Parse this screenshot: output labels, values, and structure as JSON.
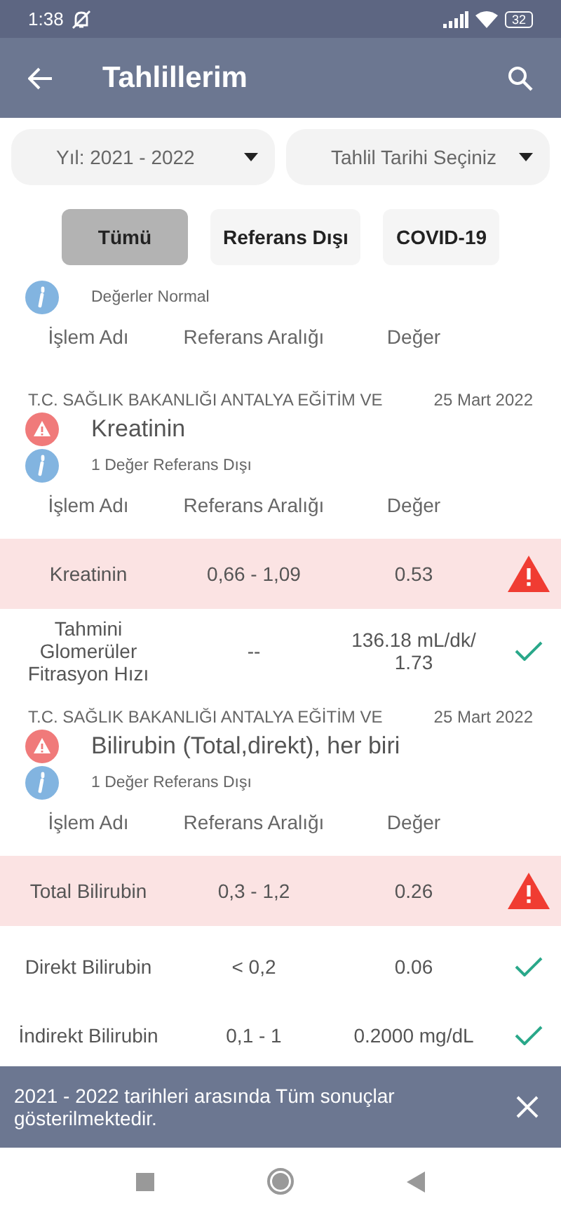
{
  "status_bar": {
    "time": "1:38",
    "battery": "32"
  },
  "app_bar": {
    "title": "Tahlillerim"
  },
  "dropdowns": [
    {
      "label": "Yıl: 2021 - 2022"
    },
    {
      "label": "Tahlil Tarihi Seçiniz"
    }
  ],
  "tabs": [
    {
      "label": "Tümü",
      "selected": true
    },
    {
      "label": "Referans Dışı",
      "selected": false
    },
    {
      "label": "COVID-19",
      "selected": false
    }
  ],
  "sections": [
    {
      "info": "Değerler Normal",
      "columns": [
        "İşlem Adı",
        "Referans Aralığı",
        "Değer"
      ]
    },
    {
      "hospital": "T.C. SAĞLIK BAKANLIĞI ANTALYA EĞİTİM VE",
      "date": "25 Mart 2022",
      "test_name": "Kreatinin",
      "alert": true,
      "info": "1 Değer Referans Dışı",
      "columns": [
        "İşlem Adı",
        "Referans Aralığı",
        "Değer"
      ],
      "rows": [
        {
          "name": "Kreatinin",
          "range": "0,66 - 1,09",
          "value": "0.53",
          "out_of_range": true
        },
        {
          "name": "Tahmini Glomerüler Fitrasyon Hızı",
          "range": "--",
          "value": "136.18 mL/dk/ 1.73",
          "out_of_range": false
        }
      ]
    },
    {
      "hospital": "T.C. SAĞLIK BAKANLIĞI ANTALYA EĞİTİM VE",
      "date": "25 Mart 2022",
      "test_name": "Bilirubin (Total,direkt), her biri",
      "alert": true,
      "info": "1 Değer Referans Dışı",
      "columns": [
        "İşlem Adı",
        "Referans Aralığı",
        "Değer"
      ],
      "rows": [
        {
          "name": "Total Bilirubin",
          "range": "0,3 - 1,2",
          "value": "0.26",
          "out_of_range": true
        },
        {
          "name": "Direkt Bilirubin",
          "range": "<    0,2",
          "value": "0.06",
          "out_of_range": false
        },
        {
          "name": "İndirekt Bilirubin",
          "range": "0,1 - 1",
          "value": "0.2000 mg/dL",
          "out_of_range": false
        }
      ]
    }
  ],
  "snackbar": {
    "message": "2021 - 2022 tarihleri arasında Tüm sonuçlar gösterilmektedir."
  }
}
